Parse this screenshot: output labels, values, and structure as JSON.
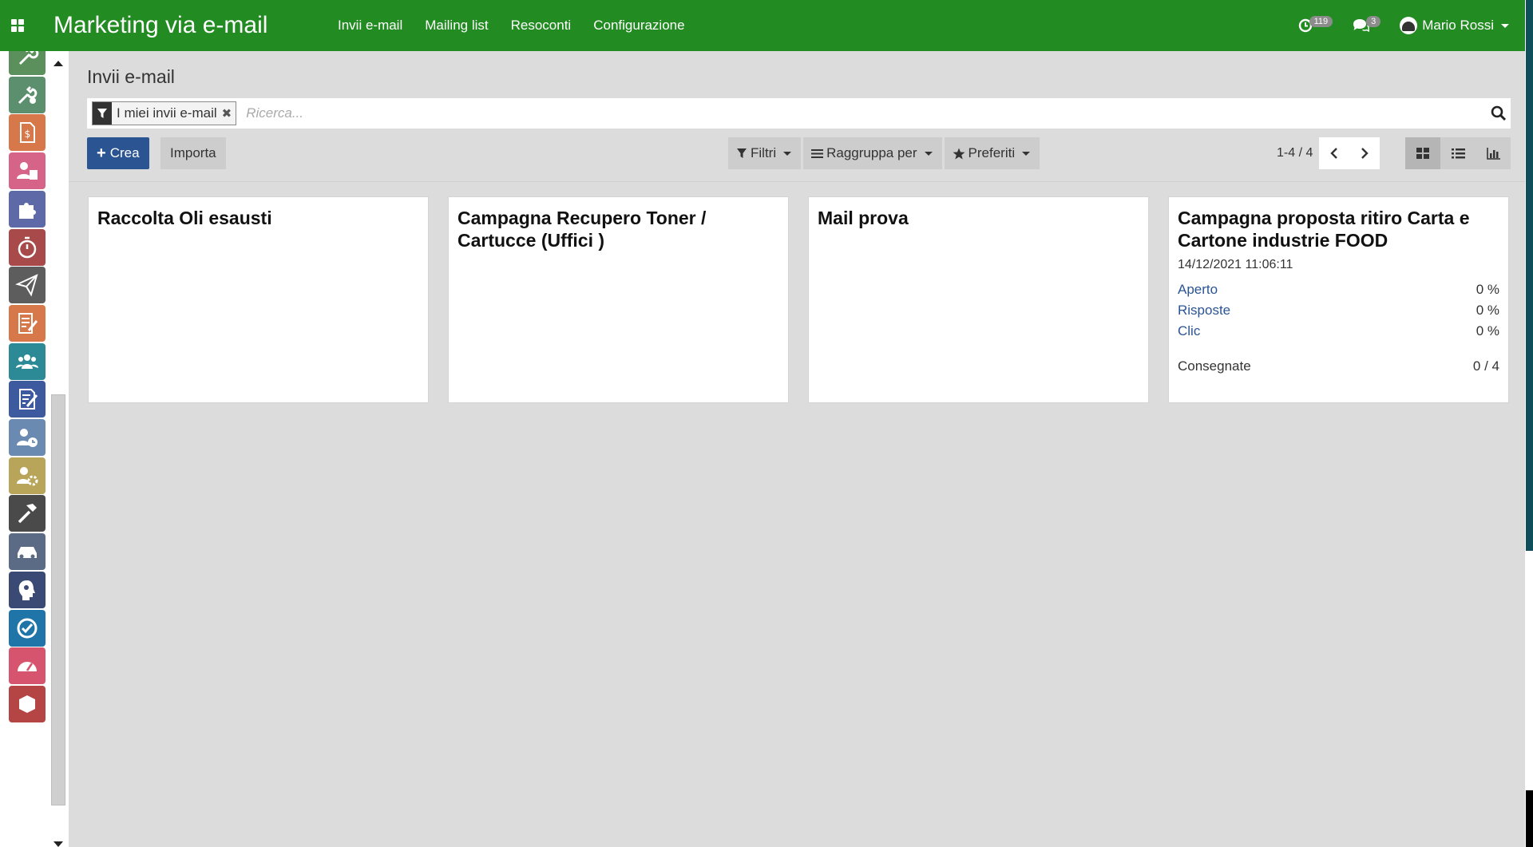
{
  "app": {
    "title": "Marketing via e-mail",
    "menu": [
      "Invii e-mail",
      "Mailing list",
      "Resoconti",
      "Configurazione"
    ],
    "activity_count": "119",
    "message_count": "3",
    "user_name": "Mario Rossi"
  },
  "sidebar": {
    "apps": [
      {
        "icon": "wrench-icon",
        "color": "#5b8f5b"
      },
      {
        "icon": "tools-icon",
        "color": "#5b8f6e"
      },
      {
        "icon": "invoice-icon",
        "color": "#d6784a"
      },
      {
        "icon": "payroll-icon",
        "color": "#d66388"
      },
      {
        "icon": "puzzle-icon",
        "color": "#5e6aa8"
      },
      {
        "icon": "stopwatch-icon",
        "color": "#a84a4a"
      },
      {
        "icon": "paper-plane-icon",
        "color": "#5d5d5d"
      },
      {
        "icon": "checklist-icon",
        "color": "#d6784a"
      },
      {
        "icon": "team-icon",
        "color": "#2b8a95"
      },
      {
        "icon": "document-edit-icon",
        "color": "#3d5a9e"
      },
      {
        "icon": "user-clock-icon",
        "color": "#6a8ab2"
      },
      {
        "icon": "user-gear-icon",
        "color": "#b8a55a"
      },
      {
        "icon": "hammer-icon",
        "color": "#4a4a4a"
      },
      {
        "icon": "car-icon",
        "color": "#5b6b85"
      },
      {
        "icon": "brain-icon",
        "color": "#3a4a75"
      },
      {
        "icon": "sync-check-icon",
        "color": "#1f75a8"
      },
      {
        "icon": "dashboard-icon",
        "color": "#d6546e"
      },
      {
        "icon": "box-icon",
        "color": "#b54545"
      }
    ]
  },
  "control": {
    "breadcrumb": "Invii e-mail",
    "facet": "I miei invii e-mail",
    "search_placeholder": "Ricerca...",
    "create": "Crea",
    "import": "Importa",
    "filters": "Filtri",
    "group_by": "Raggruppa per",
    "favorites": "Preferiti",
    "pager": "1-4 / 4"
  },
  "cards": [
    {
      "title": "Raccolta Oli esausti"
    },
    {
      "title": "Campagna Recupero Toner / Cartucce (Uffici )"
    },
    {
      "title": "Mail prova"
    },
    {
      "title": "Campagna proposta ritiro Carta e Cartone industrie FOOD",
      "date": "14/12/2021 11:06:11",
      "stats": [
        {
          "label": "Aperto",
          "value": "0 %"
        },
        {
          "label": "Risposte",
          "value": "0 %"
        },
        {
          "label": "Clic",
          "value": "0 %"
        }
      ],
      "delivered_label": "Consegnate",
      "delivered_value": "0 / 4"
    }
  ]
}
